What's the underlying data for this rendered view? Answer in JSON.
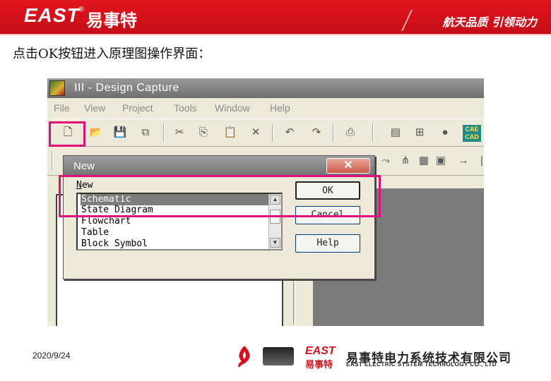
{
  "header": {
    "logo": "EAST",
    "logo_mark": "®",
    "logo_cn": "易事特",
    "slogan": "航天品质 引领动力"
  },
  "caption": "点击OK按钮进入原理图操作界面：",
  "app": {
    "title": "III - Design Capture",
    "menu": [
      "File",
      "View",
      "Project",
      "Tools",
      "Window",
      "Help"
    ],
    "toolbar_badge": [
      "CAE",
      "CAD"
    ]
  },
  "dialog": {
    "title": "New",
    "list_label_underlined": "N",
    "list_label_rest": "ew",
    "items": [
      "Schematic",
      "State Diagram",
      "Flowchart",
      "Table",
      "Block Symbol"
    ],
    "selected": "Schematic",
    "buttons": {
      "ok": "OK",
      "cancel": "Cancel",
      "help": "Help"
    },
    "close_glyph": "✕"
  },
  "footer": {
    "date": "2020/9/24",
    "east": "EAST",
    "east_cn": "易事特",
    "company": "易事特电力系统技术有限公司",
    "company_en": "EAST ELECTRIC SYSTEM TECHNOLOGY CO., LTD"
  },
  "colors": {
    "brand_red": "#d6101a",
    "highlight": "#e0107a"
  }
}
